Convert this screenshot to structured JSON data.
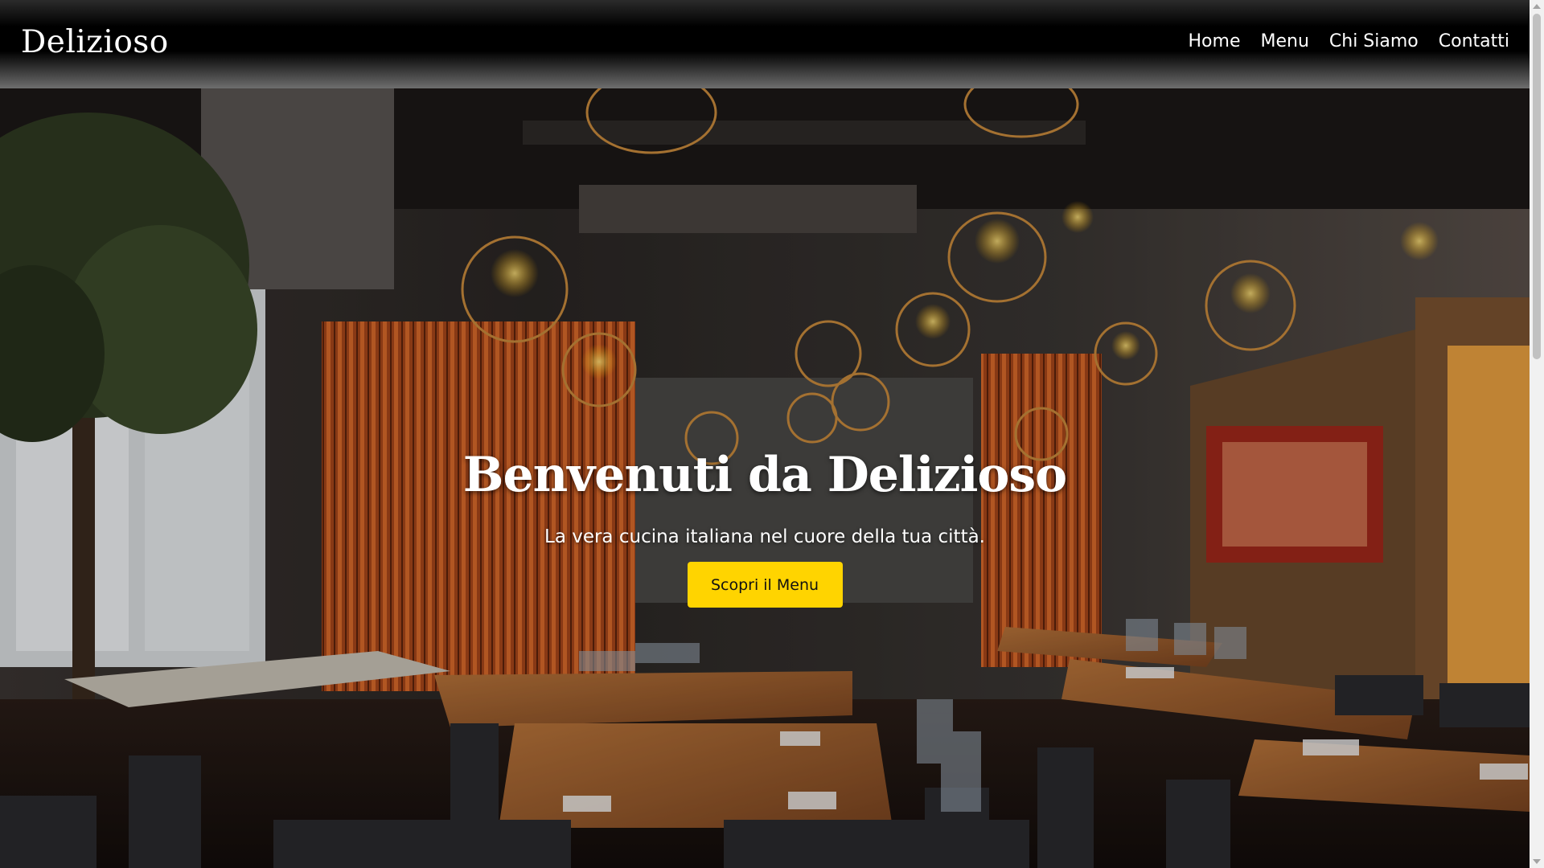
{
  "brand": {
    "name": "Delizioso"
  },
  "nav": {
    "items": [
      {
        "label": "Home"
      },
      {
        "label": "Menu"
      },
      {
        "label": "Chi Siamo"
      },
      {
        "label": "Contatti"
      }
    ]
  },
  "hero": {
    "title": "Benvenuti da Delizioso",
    "subtitle": "La vera cucina italiana nel cuore della tua città.",
    "cta_label": "Scopri il Menu",
    "background_image": "restaurant-interior",
    "cta_color": "#ffd400"
  }
}
